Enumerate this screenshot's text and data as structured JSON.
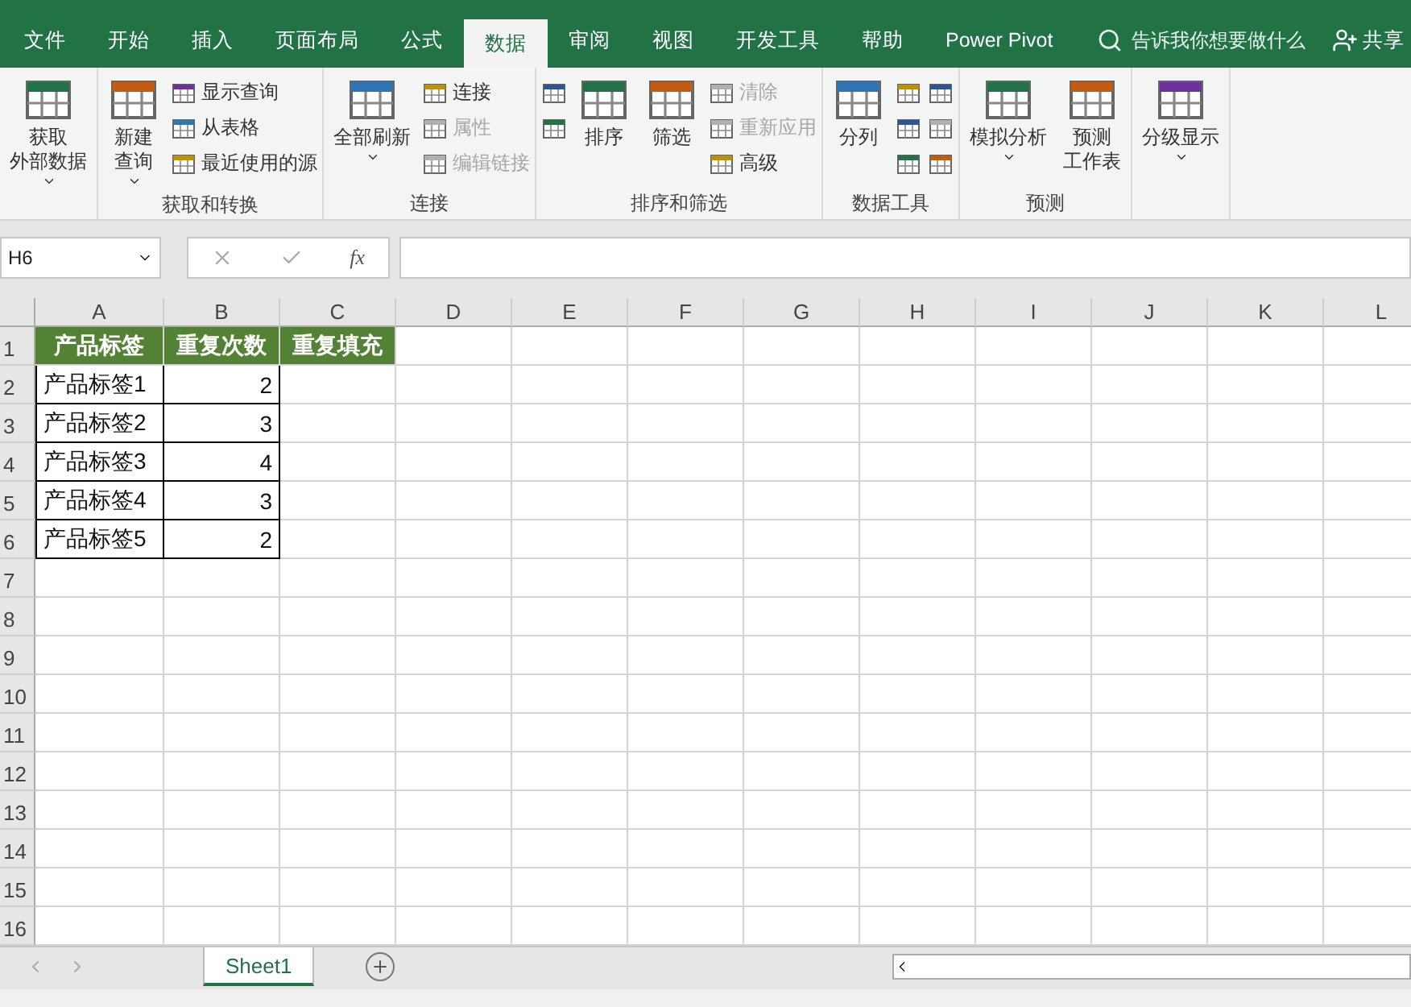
{
  "tabs": [
    {
      "label": "文件",
      "selected": false
    },
    {
      "label": "开始",
      "selected": false
    },
    {
      "label": "插入",
      "selected": false
    },
    {
      "label": "页面布局",
      "selected": false
    },
    {
      "label": "公式",
      "selected": false
    },
    {
      "label": "数据",
      "selected": true
    },
    {
      "label": "审阅",
      "selected": false
    },
    {
      "label": "视图",
      "selected": false
    },
    {
      "label": "开发工具",
      "selected": false
    },
    {
      "label": "帮助",
      "selected": false
    },
    {
      "label": "Power Pivot",
      "selected": false
    }
  ],
  "search": {
    "placeholder": "告诉我你想要做什么"
  },
  "share": {
    "label": "共享"
  },
  "ribbon": {
    "groups": [
      {
        "items": [
          {
            "kind": "large",
            "lines": [
              "获取",
              "外部数据"
            ],
            "dropdown": true,
            "disabled": false
          }
        ]
      },
      {
        "label": "获取和转换",
        "items": [
          {
            "kind": "large",
            "lines": [
              "新建",
              "查询"
            ],
            "dropdown": true,
            "disabled": false
          },
          {
            "kind": "stack",
            "buttons": [
              {
                "label": "显示查询",
                "disabled": false
              },
              {
                "label": "从表格",
                "disabled": false
              },
              {
                "label": "最近使用的源",
                "disabled": false
              }
            ]
          }
        ]
      },
      {
        "label": "连接",
        "items": [
          {
            "kind": "large",
            "lines": [
              "全部刷新"
            ],
            "dropdown": true,
            "disabled": false
          },
          {
            "kind": "stack",
            "buttons": [
              {
                "label": "连接",
                "disabled": false
              },
              {
                "label": "属性",
                "disabled": true
              },
              {
                "label": "编辑链接",
                "disabled": true
              }
            ]
          }
        ]
      },
      {
        "label": "排序和筛选",
        "items": [
          {
            "kind": "stack",
            "buttons": [
              {
                "disabled": false
              },
              {
                "disabled": false
              }
            ]
          },
          {
            "kind": "large",
            "lines": [
              "排序"
            ],
            "dropdown": false,
            "disabled": false
          },
          {
            "kind": "large",
            "lines": [
              "筛选"
            ],
            "dropdown": false,
            "disabled": false
          },
          {
            "kind": "stack",
            "buttons": [
              {
                "label": "清除",
                "disabled": true
              },
              {
                "label": "重新应用",
                "disabled": true
              },
              {
                "label": "高级",
                "disabled": false
              }
            ]
          }
        ]
      },
      {
        "label": "数据工具",
        "items": [
          {
            "kind": "large",
            "lines": [
              "分列"
            ],
            "dropdown": false,
            "disabled": false
          },
          {
            "kind": "stack",
            "buttons": [
              {
                "disabled": false
              },
              {
                "disabled": false
              },
              {
                "disabled": false
              }
            ]
          },
          {
            "kind": "stack",
            "buttons": [
              {
                "disabled": false
              },
              {
                "disabled": true
              },
              {
                "disabled": false
              }
            ]
          }
        ]
      },
      {
        "label": "预测",
        "items": [
          {
            "kind": "large",
            "lines": [
              "模拟分析"
            ],
            "dropdown": true,
            "disabled": false
          },
          {
            "kind": "large",
            "lines": [
              "预测",
              "工作表"
            ],
            "dropdown": false,
            "disabled": false
          }
        ]
      },
      {
        "items": [
          {
            "kind": "large",
            "lines": [
              "分级显示"
            ],
            "dropdown": true,
            "disabled": false
          }
        ]
      }
    ]
  },
  "formula_bar": {
    "name_box": "H6",
    "insert_function": "fx"
  },
  "sheet": {
    "columns": [
      "A",
      "B",
      "C",
      "D",
      "E",
      "F",
      "G",
      "H",
      "I",
      "J",
      "K",
      "L"
    ],
    "row_numbers": [
      "1",
      "2",
      "3",
      "4",
      "5",
      "6",
      "7",
      "8",
      "9",
      "10",
      "11",
      "12",
      "13",
      "14",
      "15",
      "16"
    ],
    "rows": [
      {
        "kind": "header",
        "cells": [
          "产品标签",
          "重复次数",
          "重复填充"
        ]
      },
      {
        "kind": "data",
        "cells": [
          "产品标签1",
          "2"
        ]
      },
      {
        "kind": "data",
        "cells": [
          "产品标签2",
          "3"
        ]
      },
      {
        "kind": "data",
        "cells": [
          "产品标签3",
          "4"
        ]
      },
      {
        "kind": "data",
        "cells": [
          "产品标签4",
          "3"
        ]
      },
      {
        "kind": "data",
        "cells": [
          "产品标签5",
          "2"
        ]
      }
    ]
  },
  "sheet_tabs": [
    {
      "label": "Sheet1",
      "selected": true
    }
  ]
}
